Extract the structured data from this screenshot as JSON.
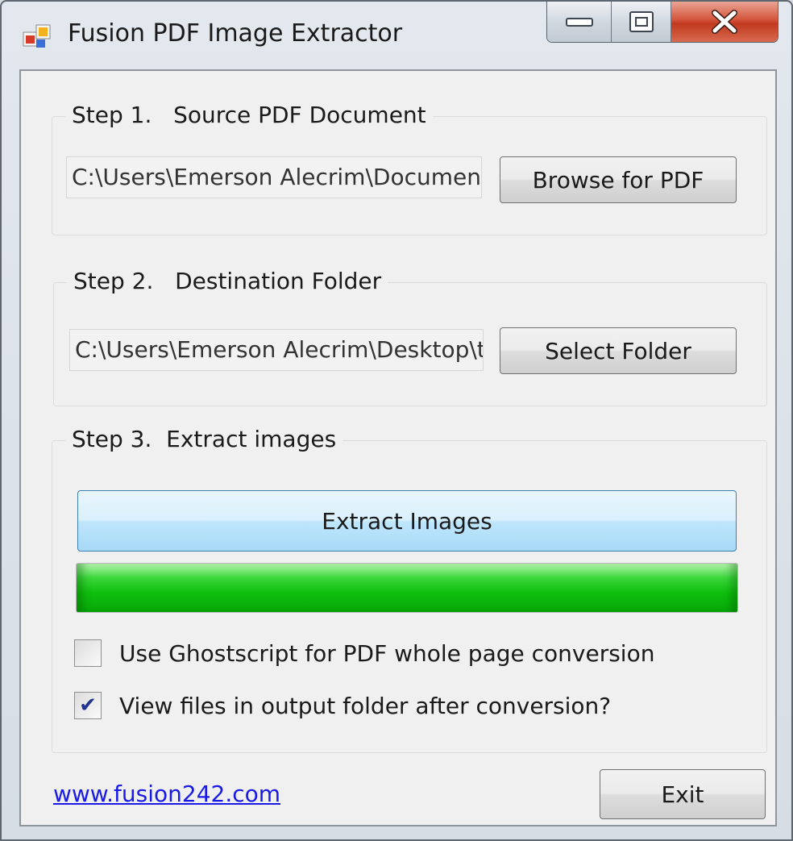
{
  "window": {
    "title": "Fusion PDF Image Extractor",
    "icon": "app-icon",
    "controls": {
      "minimize": "minimize-icon",
      "maximize": "maximize-icon",
      "close": "close-icon"
    }
  },
  "step1": {
    "title": "Step 1.   Source PDF Document",
    "path_value": "C:\\Users\\Emerson Alecrim\\Documents",
    "browse_label": "Browse for PDF"
  },
  "step2": {
    "title": "Step 2.   Destination Folder",
    "path_value": "C:\\Users\\Emerson Alecrim\\Desktop\\t",
    "select_label": "Select Folder"
  },
  "step3": {
    "title": "Step 3.  Extract images",
    "extract_label": "Extract Images",
    "progress_percent": 100,
    "progress_color": "#1cc41c",
    "options": [
      {
        "label": "Use Ghostscript for PDF whole page conversion",
        "checked": false
      },
      {
        "label": "View files in output folder after conversion?",
        "checked": true
      }
    ]
  },
  "footer": {
    "link": "www.fusion242.com",
    "exit_label": "Exit"
  }
}
